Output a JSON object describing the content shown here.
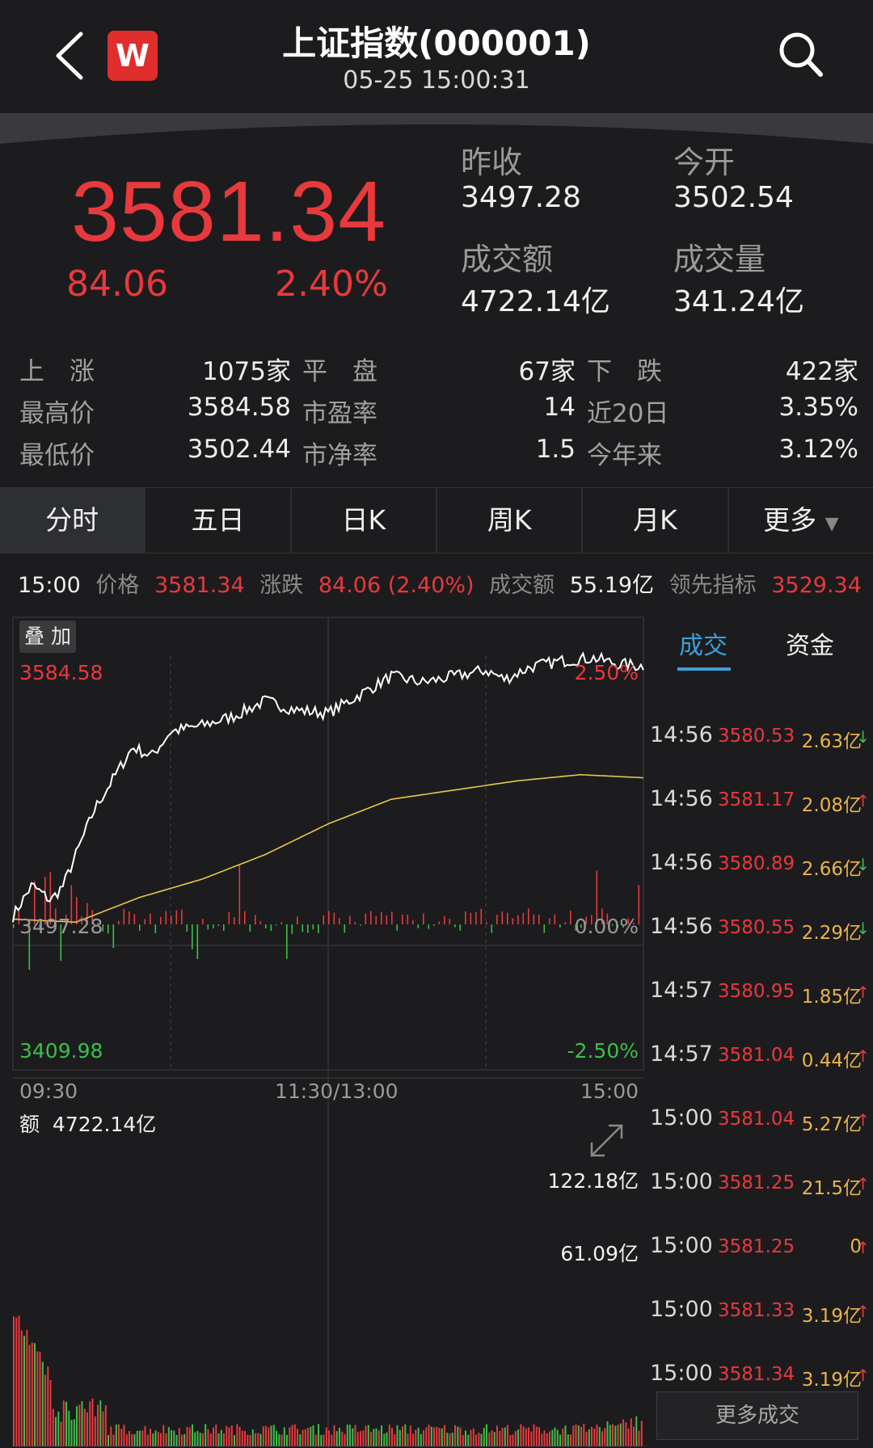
{
  "header": {
    "title": "上证指数(000001)",
    "datetime": "05-25 15:00:31",
    "logo_text": "W",
    "back_icon": "chevron-left-icon",
    "search_icon": "search-icon"
  },
  "quote": {
    "price": "3581.34",
    "change": "84.06",
    "change_pct": "2.40%",
    "prev_close_label": "昨收",
    "prev_close": "3497.28",
    "open_label": "今开",
    "open": "3502.54",
    "turnover_label": "成交额",
    "turnover": "4722.14亿",
    "volume_label": "成交量",
    "volume": "341.24亿"
  },
  "stats": {
    "up_label": "上　涨",
    "up_value": "1075家",
    "flat_label": "平　盘",
    "flat_value": "67家",
    "down_label": "下　跌",
    "down_value": "422家",
    "high_label": "最高价",
    "high_value": "3584.58",
    "pe_label": "市盈率",
    "pe_value": "14",
    "d20_label": "近20日",
    "d20_value": "3.35%",
    "low_label": "最低价",
    "low_value": "3502.44",
    "pb_label": "市净率",
    "pb_value": "1.5",
    "ytd_label": "今年来",
    "ytd_value": "3.12%"
  },
  "tabs": [
    "分时",
    "五日",
    "日K",
    "周K",
    "月K",
    "更多"
  ],
  "active_tab": "分时",
  "info_line": {
    "time": "15:00",
    "price_label": "价格",
    "price": "3581.34",
    "change_label": "涨跌",
    "change": "84.06 (2.40%)",
    "amount_label": "成交额",
    "amount": "55.19亿",
    "lead_label": "领先指标",
    "lead": "3529.34"
  },
  "chart": {
    "overlay_label": "叠 加",
    "y_high": "3584.58",
    "y_mid": "3497.28",
    "y_low": "3409.98",
    "pct_high": "2.50%",
    "pct_mid": "0.00%",
    "pct_low": "-2.50%",
    "x_start": "09:30",
    "x_mid": "11:30/13:00",
    "x_end": "15:00",
    "amount_label": "额",
    "amount_total": "4722.14亿",
    "vol_high": "122.18亿",
    "vol_mid": "61.09亿",
    "colors": {
      "up": "#e8393d",
      "down": "#3bbf4a",
      "price_line": "#ffffff",
      "avg_line": "#e6c84a",
      "accent": "#3aa0d8"
    }
  },
  "side_panel": {
    "tab_trades": "成交",
    "tab_funds": "资金",
    "trades": [
      {
        "time": "14:56",
        "price": "3580.53",
        "vol": "2.63亿",
        "dir": "↓"
      },
      {
        "time": "14:56",
        "price": "3581.17",
        "vol": "2.08亿",
        "dir": "↑"
      },
      {
        "time": "14:56",
        "price": "3580.89",
        "vol": "2.66亿",
        "dir": "↓"
      },
      {
        "time": "14:56",
        "price": "3580.55",
        "vol": "2.29亿",
        "dir": "↓"
      },
      {
        "time": "14:57",
        "price": "3580.95",
        "vol": "1.85亿",
        "dir": "↑"
      },
      {
        "time": "14:57",
        "price": "3581.04",
        "vol": "0.44亿",
        "dir": "↑"
      },
      {
        "time": "15:00",
        "price": "3581.04",
        "vol": "5.27亿",
        "dir": "↑"
      },
      {
        "time": "15:00",
        "price": "3581.25",
        "vol": "21.5亿",
        "dir": "↑"
      },
      {
        "time": "15:00",
        "price": "3581.25",
        "vol": "0",
        "dir": "↑"
      },
      {
        "time": "15:00",
        "price": "3581.33",
        "vol": "3.19亿",
        "dir": "↑"
      },
      {
        "time": "15:00",
        "price": "3581.34",
        "vol": "3.19亿",
        "dir": "↑"
      }
    ],
    "more_label": "更多成交"
  }
}
